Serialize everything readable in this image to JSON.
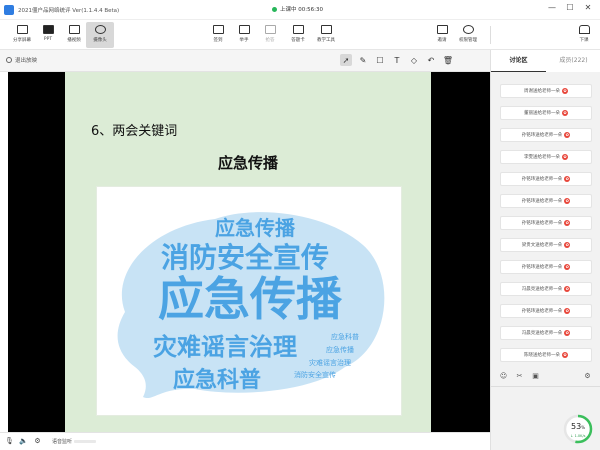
{
  "window": {
    "title": "2021僵户品网络统评 Ver(1.1.4.4 Beta)",
    "live_status": "上课中 00:56:30",
    "controls": [
      "—",
      "☐",
      "✕"
    ]
  },
  "toolbar": {
    "left_buttons": [
      {
        "name": "share-screen",
        "label": "分享屏幕"
      },
      {
        "name": "ppt",
        "label": "PPT"
      },
      {
        "name": "play-video",
        "label": "播视频"
      },
      {
        "name": "camera",
        "label": "摄像头"
      }
    ],
    "center_buttons": [
      {
        "name": "roll-call",
        "label": "签到"
      },
      {
        "name": "hands-up",
        "label": "举手"
      },
      {
        "name": "quiz",
        "label": "抢答"
      },
      {
        "name": "answer-card",
        "label": "答题卡"
      },
      {
        "name": "teaching-tools",
        "label": "教学工具"
      }
    ],
    "right_buttons": [
      {
        "name": "invite",
        "label": "邀请"
      },
      {
        "name": "permission-manage",
        "label": "权限管理"
      }
    ],
    "end_class_label": "下课"
  },
  "annotation_bar": {
    "exit_label": "退出放映",
    "tools": [
      "pointer",
      "pen",
      "shape",
      "text",
      "eraser",
      "undo",
      "delete"
    ]
  },
  "slide": {
    "heading": "6、两会关键词",
    "subtitle": "应急传播",
    "wordcloud": [
      {
        "text": "应急传播",
        "weight": 1
      },
      {
        "text": "消防安全宣传",
        "weight": 0.7
      },
      {
        "text": "灾难谣言治理",
        "weight": 0.6
      },
      {
        "text": "应急科普",
        "weight": 0.55
      },
      {
        "text": "应急传播",
        "weight": 0.5
      },
      {
        "text": "消防安全宣传",
        "weight": 0.15
      },
      {
        "text": "应急科普",
        "weight": 0.15
      },
      {
        "text": "应急传播",
        "weight": 0.15
      },
      {
        "text": "灾难谣言治理",
        "weight": 0.15
      }
    ]
  },
  "bottom_bar": {
    "audio_label": "语音监听"
  },
  "side_panel": {
    "tabs": [
      {
        "label": "讨论区",
        "active": true
      },
      {
        "label": "成员(222)",
        "active": false
      }
    ],
    "messages": [
      "周谢送给老师一朵",
      "董丽送给老师一朵",
      "孙铭玮送给老师一朵",
      "李雯送给老师一朵",
      "孙铭玮送给老师一朵",
      "孙铭玮送给老师一朵",
      "孙铭玮送给老师一朵",
      "梁贵文送给老师一朵",
      "孙铭玮送给老师一朵",
      "冯晨亮送给老师一朵",
      "孙铭玮送给老师一朵",
      "冯晨亮送给老师一朵",
      "陈晓送给老师一朵"
    ],
    "flower_glyph": "✿"
  },
  "network": {
    "quality": "53",
    "unit": "%",
    "speed": "↓ 1.0K/s",
    "quality_fraction": 0.53
  },
  "colors": {
    "slide_bg": "#dcecd6",
    "cloud_main": "#4ba3e3",
    "cloud_bg": "#c8e3f5",
    "accent_red": "#e8463a",
    "live_green": "#27b65a"
  }
}
